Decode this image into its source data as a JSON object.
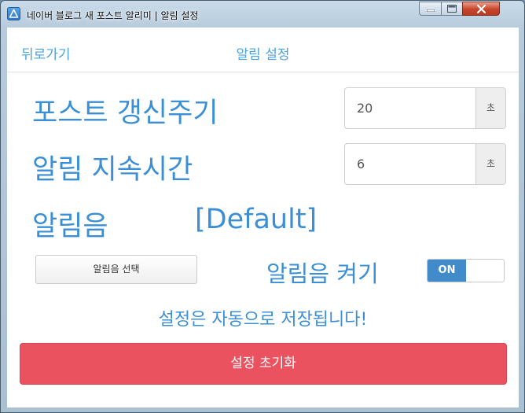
{
  "window": {
    "title": "네이버 블로그 새 포스트 알리미 | 알림 설정"
  },
  "navbar": {
    "back_label": "뒤로가기",
    "title": "알림 설정"
  },
  "settings": {
    "refresh": {
      "label": "포스트 갱신주기",
      "value": "20",
      "unit": "초"
    },
    "duration": {
      "label": "알림 지속시간",
      "value": "6",
      "unit": "초"
    },
    "sound": {
      "label": "알림음",
      "current": "[Default]",
      "select_button": "알림음 선택",
      "toggle_label": "알림음 켜기",
      "toggle_state": "ON"
    }
  },
  "autosave_message": "설정은 자동으로 저장됩니다!",
  "reset_button": "설정 초기화",
  "colors": {
    "accent": "#3b8fd6",
    "link": "#4aa3df",
    "danger": "#ea5260",
    "toggle_on": "#428bca"
  }
}
